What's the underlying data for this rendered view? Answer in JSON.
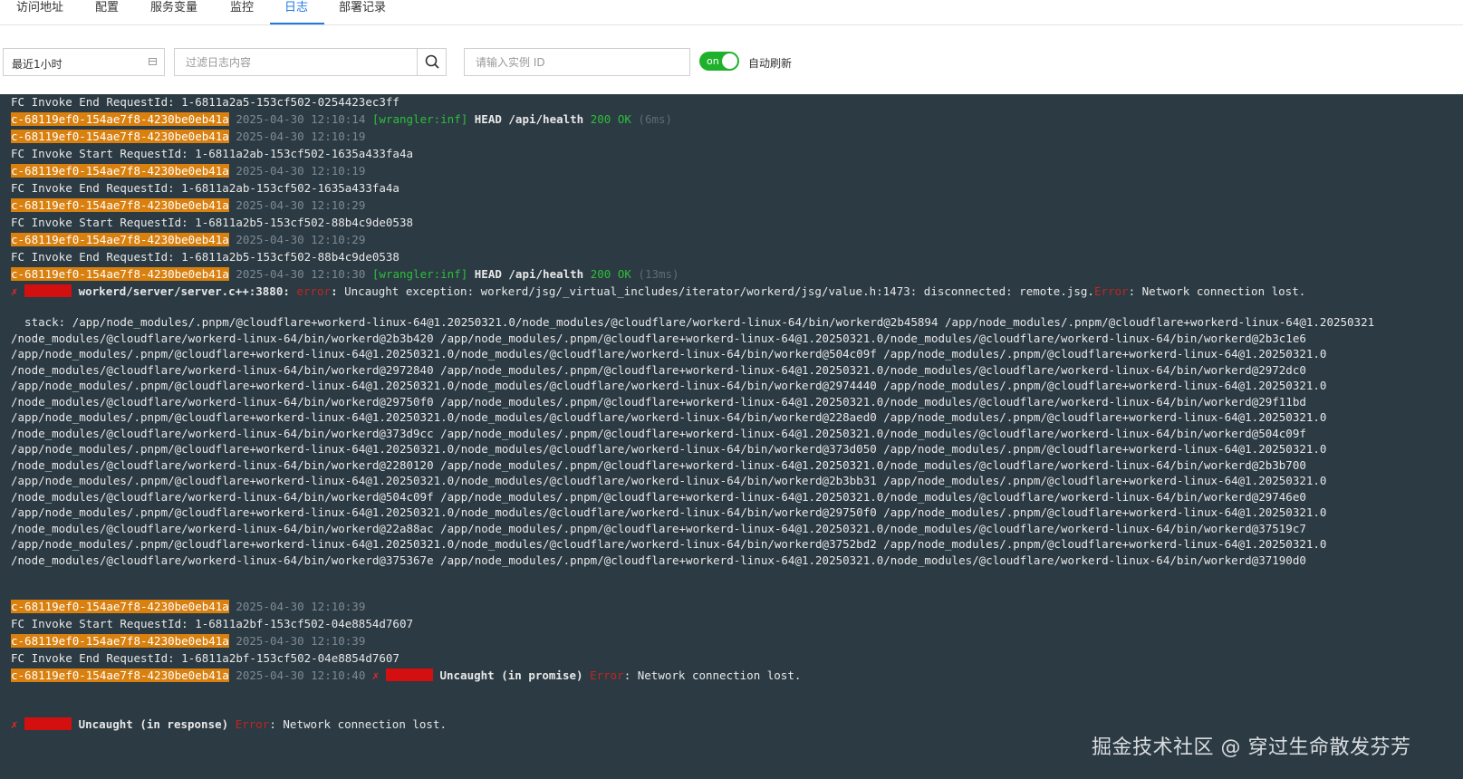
{
  "tabs": [
    {
      "label": "访问地址"
    },
    {
      "label": "配置"
    },
    {
      "label": "服务变量"
    },
    {
      "label": "监控"
    },
    {
      "label": "日志",
      "active": true
    },
    {
      "label": "部署记录"
    }
  ],
  "toolbar": {
    "time_range": "最近1小时",
    "filter_placeholder": "过滤日志内容",
    "instance_placeholder": "请输入实例 ID",
    "toggle_text": "on",
    "auto_refresh_label": "自动刷新"
  },
  "log": {
    "instance": "c-68119ef0-154ae7f8-4230be0eb41a",
    "lines": [
      {
        "kind": "fc",
        "text": "FC Invoke End RequestId: 1-6811a2a5-153cf502-0254423ec3ff"
      },
      {
        "kind": "req",
        "ts": "2025-04-30 12:10:14",
        "wrangler": "[wrangler:inf]",
        "method": "HEAD /api/health",
        "status": "200 OK",
        "dur": "(6ms)"
      },
      {
        "kind": "ts",
        "ts": "2025-04-30 12:10:19"
      },
      {
        "kind": "fc",
        "text": "FC Invoke Start RequestId: 1-6811a2ab-153cf502-1635a433fa4a"
      },
      {
        "kind": "ts",
        "ts": "2025-04-30 12:10:19"
      },
      {
        "kind": "fc",
        "text": "FC Invoke End RequestId: 1-6811a2ab-153cf502-1635a433fa4a"
      },
      {
        "kind": "ts",
        "ts": "2025-04-30 12:10:29"
      },
      {
        "kind": "fc",
        "text": "FC Invoke Start RequestId: 1-6811a2b5-153cf502-88b4c9de0538"
      },
      {
        "kind": "ts",
        "ts": "2025-04-30 12:10:29"
      },
      {
        "kind": "fc",
        "text": "FC Invoke End RequestId: 1-6811a2b5-153cf502-88b4c9de0538"
      },
      {
        "kind": "req",
        "ts": "2025-04-30 12:10:30",
        "wrangler": "[wrangler:inf]",
        "method": "HEAD /api/health",
        "status": "200 OK",
        "dur": "(13ms)"
      }
    ],
    "error1": {
      "x": "✗",
      "source": "workerd/server/server.c++:3880:",
      "level": "error",
      "msg1": "Uncaught exception: workerd/jsg/_virtual_includes/iterator/workerd/jsg/value.h:1473: disconnected: remote.jsg.",
      "word": "Error",
      "msg2": ": Network connection lost."
    },
    "stack": [
      "  stack: /app/node_modules/.pnpm/@cloudflare+workerd-linux-64@1.20250321.0/node_modules/@cloudflare/workerd-linux-64/bin/workerd@2b45894 /app/node_modules/.pnpm/@cloudflare+workerd-linux-64@1.20250321",
      "/node_modules/@cloudflare/workerd-linux-64/bin/workerd@2b3b420 /app/node_modules/.pnpm/@cloudflare+workerd-linux-64@1.20250321.0/node_modules/@cloudflare/workerd-linux-64/bin/workerd@2b3c1e6",
      "/app/node_modules/.pnpm/@cloudflare+workerd-linux-64@1.20250321.0/node_modules/@cloudflare/workerd-linux-64/bin/workerd@504c09f /app/node_modules/.pnpm/@cloudflare+workerd-linux-64@1.20250321.0",
      "/node_modules/@cloudflare/workerd-linux-64/bin/workerd@2972840 /app/node_modules/.pnpm/@cloudflare+workerd-linux-64@1.20250321.0/node_modules/@cloudflare/workerd-linux-64/bin/workerd@2972dc0",
      "/app/node_modules/.pnpm/@cloudflare+workerd-linux-64@1.20250321.0/node_modules/@cloudflare/workerd-linux-64/bin/workerd@2974440 /app/node_modules/.pnpm/@cloudflare+workerd-linux-64@1.20250321.0",
      "/node_modules/@cloudflare/workerd-linux-64/bin/workerd@29750f0 /app/node_modules/.pnpm/@cloudflare+workerd-linux-64@1.20250321.0/node_modules/@cloudflare/workerd-linux-64/bin/workerd@29f11bd",
      "/app/node_modules/.pnpm/@cloudflare+workerd-linux-64@1.20250321.0/node_modules/@cloudflare/workerd-linux-64/bin/workerd@228aed0 /app/node_modules/.pnpm/@cloudflare+workerd-linux-64@1.20250321.0",
      "/node_modules/@cloudflare/workerd-linux-64/bin/workerd@373d9cc /app/node_modules/.pnpm/@cloudflare+workerd-linux-64@1.20250321.0/node_modules/@cloudflare/workerd-linux-64/bin/workerd@504c09f",
      "/app/node_modules/.pnpm/@cloudflare+workerd-linux-64@1.20250321.0/node_modules/@cloudflare/workerd-linux-64/bin/workerd@373d050 /app/node_modules/.pnpm/@cloudflare+workerd-linux-64@1.20250321.0",
      "/node_modules/@cloudflare/workerd-linux-64/bin/workerd@2280120 /app/node_modules/.pnpm/@cloudflare+workerd-linux-64@1.20250321.0/node_modules/@cloudflare/workerd-linux-64/bin/workerd@2b3b700",
      "/app/node_modules/.pnpm/@cloudflare+workerd-linux-64@1.20250321.0/node_modules/@cloudflare/workerd-linux-64/bin/workerd@2b3bb31 /app/node_modules/.pnpm/@cloudflare+workerd-linux-64@1.20250321.0",
      "/node_modules/@cloudflare/workerd-linux-64/bin/workerd@504c09f /app/node_modules/.pnpm/@cloudflare+workerd-linux-64@1.20250321.0/node_modules/@cloudflare/workerd-linux-64/bin/workerd@29746e0",
      "/app/node_modules/.pnpm/@cloudflare+workerd-linux-64@1.20250321.0/node_modules/@cloudflare/workerd-linux-64/bin/workerd@29750f0 /app/node_modules/.pnpm/@cloudflare+workerd-linux-64@1.20250321.0",
      "/node_modules/@cloudflare/workerd-linux-64/bin/workerd@22a88ac /app/node_modules/.pnpm/@cloudflare+workerd-linux-64@1.20250321.0/node_modules/@cloudflare/workerd-linux-64/bin/workerd@37519c7",
      "/app/node_modules/.pnpm/@cloudflare+workerd-linux-64@1.20250321.0/node_modules/@cloudflare/workerd-linux-64/bin/workerd@3752bd2 /app/node_modules/.pnpm/@cloudflare+workerd-linux-64@1.20250321.0",
      "/node_modules/@cloudflare/workerd-linux-64/bin/workerd@375367e /app/node_modules/.pnpm/@cloudflare+workerd-linux-64@1.20250321.0/node_modules/@cloudflare/workerd-linux-64/bin/workerd@37190d0"
    ],
    "lines2": [
      {
        "kind": "ts",
        "ts": "2025-04-30 12:10:39"
      },
      {
        "kind": "fc",
        "text": "FC Invoke Start RequestId: 1-6811a2bf-153cf502-04e8854d7607"
      },
      {
        "kind": "ts",
        "ts": "2025-04-30 12:10:39"
      },
      {
        "kind": "fc",
        "text": "FC Invoke End RequestId: 1-6811a2bf-153cf502-04e8854d7607"
      }
    ],
    "promise_line": {
      "ts": "2025-04-30 12:10:40",
      "x": "✗",
      "msg": "Uncaught (in promise)",
      "word": "Error",
      "rest": ": Network connection lost."
    },
    "response_line": {
      "x": "✗",
      "msg": "Uncaught (in response)",
      "word": "Error",
      "rest": ": Network connection lost."
    }
  },
  "watermark": "掘金技术社区 @ 穿过生命散发芬芳"
}
